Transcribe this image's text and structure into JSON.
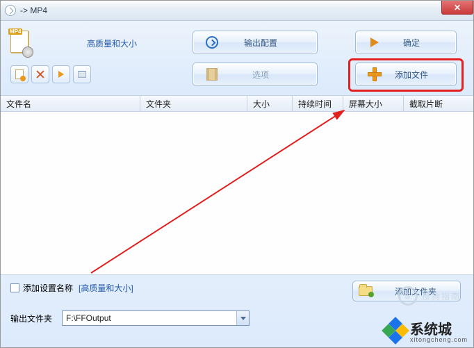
{
  "window": {
    "title": "-> MP4"
  },
  "top": {
    "quality_label": "高质量和大小",
    "btn_output": "输出配置",
    "btn_ok": "确定",
    "btn_options": "选项",
    "btn_add": "添加文件"
  },
  "table": {
    "columns": [
      "文件名",
      "文件夹",
      "大小",
      "持续时间",
      "屏幕大小",
      "截取片断"
    ],
    "widths": [
      201,
      154,
      65,
      73,
      87,
      80
    ]
  },
  "bottom": {
    "chk_label": "添加设置名称",
    "settings_name": "[高质量和大小]",
    "btn_add_folder": "添加文件夹",
    "output_label": "输出文件夹",
    "output_path": "F:\\FFOutput"
  },
  "watermark": {
    "sougou": "搜狗指南",
    "site_cn": "系统城",
    "site_url": "xitongcheng.com"
  }
}
